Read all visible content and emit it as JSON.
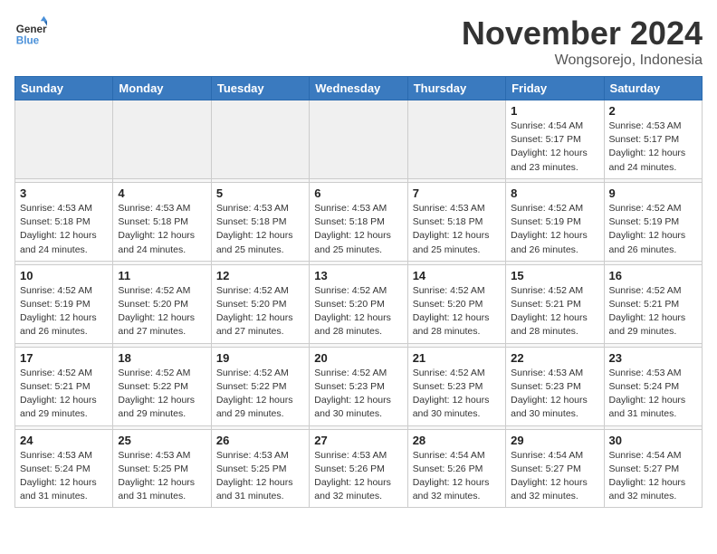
{
  "header": {
    "logo_line1": "General",
    "logo_line2": "Blue",
    "month": "November 2024",
    "location": "Wongsorejo, Indonesia"
  },
  "weekdays": [
    "Sunday",
    "Monday",
    "Tuesday",
    "Wednesday",
    "Thursday",
    "Friday",
    "Saturday"
  ],
  "weeks": [
    [
      {
        "day": "",
        "info": ""
      },
      {
        "day": "",
        "info": ""
      },
      {
        "day": "",
        "info": ""
      },
      {
        "day": "",
        "info": ""
      },
      {
        "day": "",
        "info": ""
      },
      {
        "day": "1",
        "info": "Sunrise: 4:54 AM\nSunset: 5:17 PM\nDaylight: 12 hours\nand 23 minutes."
      },
      {
        "day": "2",
        "info": "Sunrise: 4:53 AM\nSunset: 5:17 PM\nDaylight: 12 hours\nand 24 minutes."
      }
    ],
    [
      {
        "day": "3",
        "info": "Sunrise: 4:53 AM\nSunset: 5:18 PM\nDaylight: 12 hours\nand 24 minutes."
      },
      {
        "day": "4",
        "info": "Sunrise: 4:53 AM\nSunset: 5:18 PM\nDaylight: 12 hours\nand 24 minutes."
      },
      {
        "day": "5",
        "info": "Sunrise: 4:53 AM\nSunset: 5:18 PM\nDaylight: 12 hours\nand 25 minutes."
      },
      {
        "day": "6",
        "info": "Sunrise: 4:53 AM\nSunset: 5:18 PM\nDaylight: 12 hours\nand 25 minutes."
      },
      {
        "day": "7",
        "info": "Sunrise: 4:53 AM\nSunset: 5:18 PM\nDaylight: 12 hours\nand 25 minutes."
      },
      {
        "day": "8",
        "info": "Sunrise: 4:52 AM\nSunset: 5:19 PM\nDaylight: 12 hours\nand 26 minutes."
      },
      {
        "day": "9",
        "info": "Sunrise: 4:52 AM\nSunset: 5:19 PM\nDaylight: 12 hours\nand 26 minutes."
      }
    ],
    [
      {
        "day": "10",
        "info": "Sunrise: 4:52 AM\nSunset: 5:19 PM\nDaylight: 12 hours\nand 26 minutes."
      },
      {
        "day": "11",
        "info": "Sunrise: 4:52 AM\nSunset: 5:20 PM\nDaylight: 12 hours\nand 27 minutes."
      },
      {
        "day": "12",
        "info": "Sunrise: 4:52 AM\nSunset: 5:20 PM\nDaylight: 12 hours\nand 27 minutes."
      },
      {
        "day": "13",
        "info": "Sunrise: 4:52 AM\nSunset: 5:20 PM\nDaylight: 12 hours\nand 28 minutes."
      },
      {
        "day": "14",
        "info": "Sunrise: 4:52 AM\nSunset: 5:20 PM\nDaylight: 12 hours\nand 28 minutes."
      },
      {
        "day": "15",
        "info": "Sunrise: 4:52 AM\nSunset: 5:21 PM\nDaylight: 12 hours\nand 28 minutes."
      },
      {
        "day": "16",
        "info": "Sunrise: 4:52 AM\nSunset: 5:21 PM\nDaylight: 12 hours\nand 29 minutes."
      }
    ],
    [
      {
        "day": "17",
        "info": "Sunrise: 4:52 AM\nSunset: 5:21 PM\nDaylight: 12 hours\nand 29 minutes."
      },
      {
        "day": "18",
        "info": "Sunrise: 4:52 AM\nSunset: 5:22 PM\nDaylight: 12 hours\nand 29 minutes."
      },
      {
        "day": "19",
        "info": "Sunrise: 4:52 AM\nSunset: 5:22 PM\nDaylight: 12 hours\nand 29 minutes."
      },
      {
        "day": "20",
        "info": "Sunrise: 4:52 AM\nSunset: 5:23 PM\nDaylight: 12 hours\nand 30 minutes."
      },
      {
        "day": "21",
        "info": "Sunrise: 4:52 AM\nSunset: 5:23 PM\nDaylight: 12 hours\nand 30 minutes."
      },
      {
        "day": "22",
        "info": "Sunrise: 4:53 AM\nSunset: 5:23 PM\nDaylight: 12 hours\nand 30 minutes."
      },
      {
        "day": "23",
        "info": "Sunrise: 4:53 AM\nSunset: 5:24 PM\nDaylight: 12 hours\nand 31 minutes."
      }
    ],
    [
      {
        "day": "24",
        "info": "Sunrise: 4:53 AM\nSunset: 5:24 PM\nDaylight: 12 hours\nand 31 minutes."
      },
      {
        "day": "25",
        "info": "Sunrise: 4:53 AM\nSunset: 5:25 PM\nDaylight: 12 hours\nand 31 minutes."
      },
      {
        "day": "26",
        "info": "Sunrise: 4:53 AM\nSunset: 5:25 PM\nDaylight: 12 hours\nand 31 minutes."
      },
      {
        "day": "27",
        "info": "Sunrise: 4:53 AM\nSunset: 5:26 PM\nDaylight: 12 hours\nand 32 minutes."
      },
      {
        "day": "28",
        "info": "Sunrise: 4:54 AM\nSunset: 5:26 PM\nDaylight: 12 hours\nand 32 minutes."
      },
      {
        "day": "29",
        "info": "Sunrise: 4:54 AM\nSunset: 5:27 PM\nDaylight: 12 hours\nand 32 minutes."
      },
      {
        "day": "30",
        "info": "Sunrise: 4:54 AM\nSunset: 5:27 PM\nDaylight: 12 hours\nand 32 minutes."
      }
    ]
  ]
}
